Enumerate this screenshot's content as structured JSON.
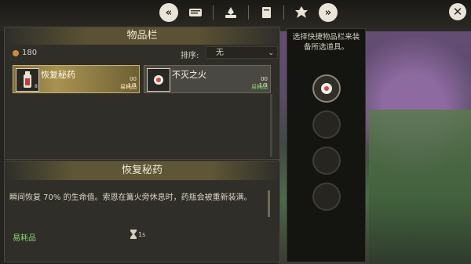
{
  "topbar": {
    "prev_icon": "rewind-icon",
    "next_icon": "fast-forward-icon",
    "tabs": [
      "map-scroll-icon",
      "campfire-icon",
      "journal-icon",
      "emblem-icon"
    ]
  },
  "inventory": {
    "title": "物品栏",
    "currency": "180",
    "sort_label": "排序:",
    "sort_value": "无",
    "items": [
      {
        "name": "恢复秘药",
        "count": "00\n1/3",
        "type": "易耗品",
        "qty": "8",
        "selected": true
      },
      {
        "name": "不灭之火",
        "count": "00\n1/3",
        "type": "易耗品",
        "selected": false
      }
    ]
  },
  "detail": {
    "title": "恢复秘药",
    "description": "瞬间恢复 70% 的生命值。索恩在篝火旁休息时，药瓶会被重新装满。",
    "type": "易耗品",
    "time": "1s"
  },
  "quickbar": {
    "instruction": "选择快捷物品栏来装备所选道具。"
  },
  "colors": {
    "accent_gold": "#a89250",
    "consumable_green": "#8ad06a",
    "panel_bg": "#2f2e29"
  }
}
